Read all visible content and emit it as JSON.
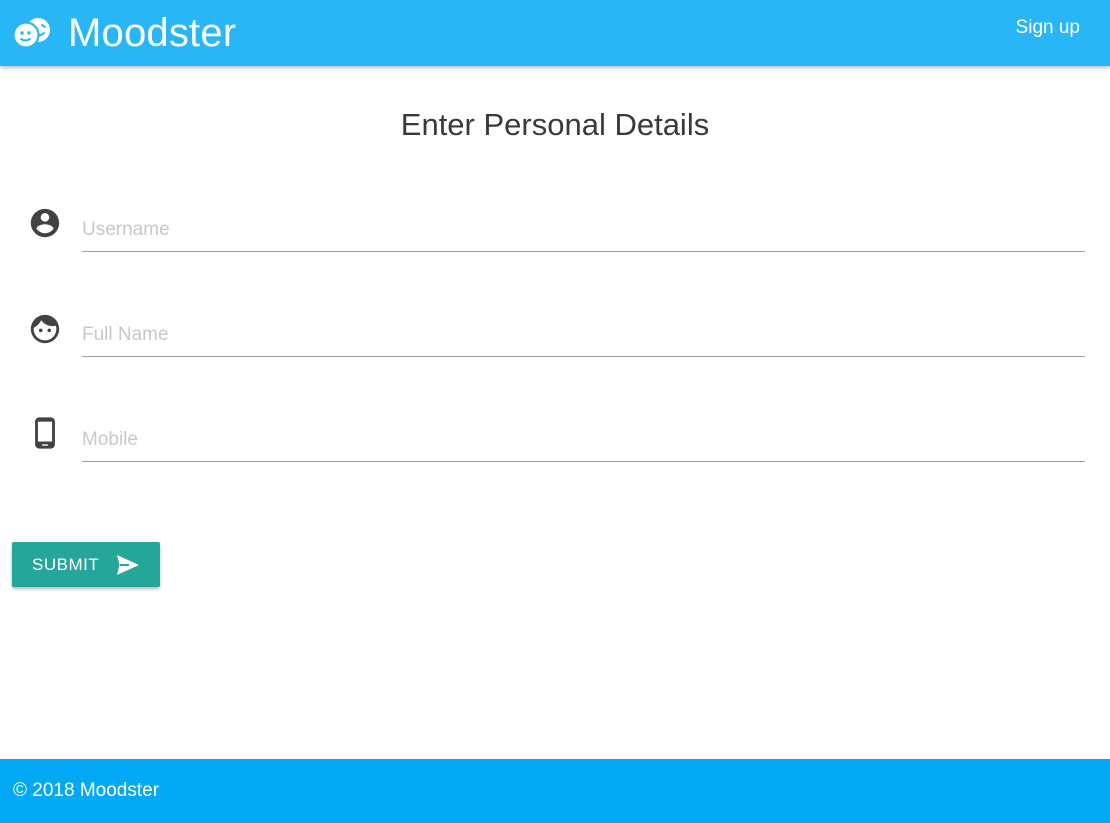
{
  "navbar": {
    "brand_name": "Moodster",
    "brand_icon": "moodster-faces-logo",
    "signup_label": "Sign up"
  },
  "heading": "Enter Personal Details",
  "form": {
    "fields": [
      {
        "icon": "account-circle-icon",
        "placeholder": "Username",
        "value": ""
      },
      {
        "icon": "face-icon",
        "placeholder": "Full Name",
        "value": ""
      },
      {
        "icon": "smartphone-icon",
        "placeholder": "Mobile",
        "value": ""
      }
    ],
    "submit_label": "SUBMIT",
    "submit_icon": "send-icon"
  },
  "footer": {
    "copyright": "© 2018 Moodster"
  },
  "colors": {
    "navbar": "#29b6f6",
    "footer": "#03a9f4",
    "submit": "#26a69a",
    "icon": "#424242"
  }
}
